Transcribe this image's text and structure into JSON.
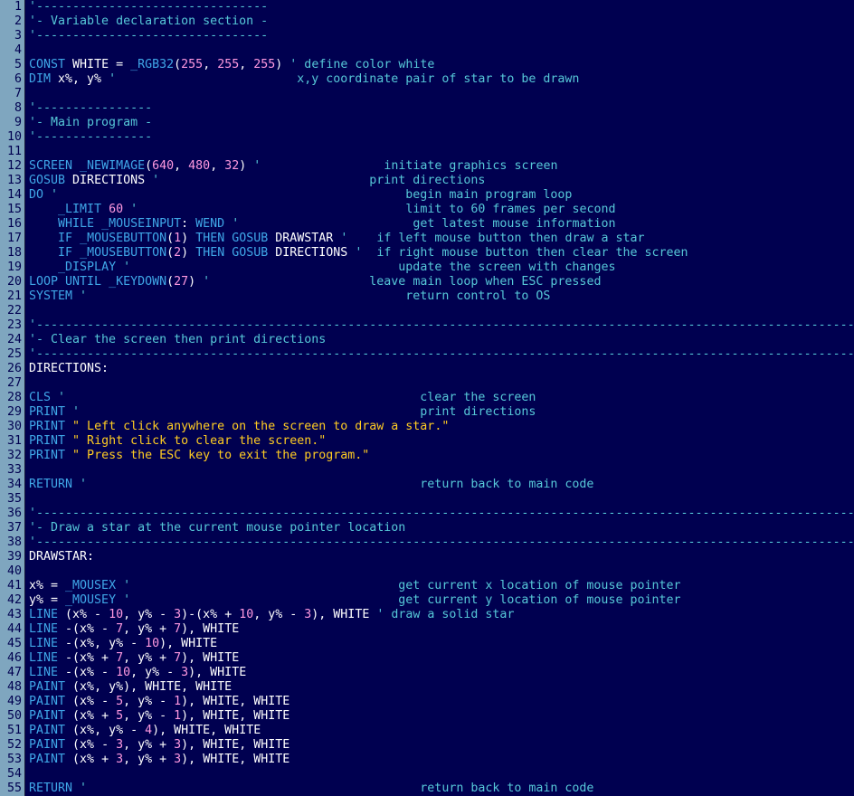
{
  "editor": {
    "theme": {
      "background": "#000050",
      "gutter": "#7fa6bf",
      "comment": "#56c8d8",
      "keyword": "#3fa7e8",
      "identifier": "#ffffff",
      "number": "#ff99e0",
      "string": "#ffcc22"
    },
    "lines": [
      [
        [
          "cm",
          "'--------------------------------"
        ]
      ],
      [
        [
          "cm",
          "'- Variable declaration section -"
        ]
      ],
      [
        [
          "cm",
          "'--------------------------------"
        ]
      ],
      [],
      [
        [
          "kw",
          "CONST "
        ],
        [
          "id",
          "WHITE = "
        ],
        [
          "mt",
          "_RGB32"
        ],
        [
          "op",
          "("
        ],
        [
          "num",
          "255"
        ],
        [
          "op",
          ", "
        ],
        [
          "num",
          "255"
        ],
        [
          "op",
          ", "
        ],
        [
          "num",
          "255"
        ],
        [
          "op",
          ") "
        ],
        [
          "cm",
          "' define color white"
        ]
      ],
      [
        [
          "kw",
          "DIM "
        ],
        [
          "id",
          "x%, y% "
        ],
        [
          "cm",
          "'                         x,y coordinate pair of star to be drawn"
        ]
      ],
      [],
      [
        [
          "cm",
          "'----------------"
        ]
      ],
      [
        [
          "cm",
          "'- Main program -"
        ]
      ],
      [
        [
          "cm",
          "'----------------"
        ]
      ],
      [],
      [
        [
          "kw",
          "SCREEN "
        ],
        [
          "mt",
          "_NEWIMAGE"
        ],
        [
          "op",
          "("
        ],
        [
          "num",
          "640"
        ],
        [
          "op",
          ", "
        ],
        [
          "num",
          "480"
        ],
        [
          "op",
          ", "
        ],
        [
          "num",
          "32"
        ],
        [
          "op",
          ") "
        ],
        [
          "cm",
          "'                 initiate graphics screen"
        ]
      ],
      [
        [
          "kw",
          "GOSUB "
        ],
        [
          "id",
          "DIRECTIONS "
        ],
        [
          "cm",
          "'                             print directions"
        ]
      ],
      [
        [
          "kw",
          "DO "
        ],
        [
          "cm",
          "'                                                begin main program loop"
        ]
      ],
      [
        [
          "op",
          "    "
        ],
        [
          "mt",
          "_LIMIT "
        ],
        [
          "num",
          "60 "
        ],
        [
          "cm",
          "'                                     limit to 60 frames per second"
        ]
      ],
      [
        [
          "op",
          "    "
        ],
        [
          "kw",
          "WHILE "
        ],
        [
          "mt",
          "_MOUSEINPUT"
        ],
        [
          "op",
          ": "
        ],
        [
          "kw",
          "WEND "
        ],
        [
          "cm",
          "'                        get latest mouse information"
        ]
      ],
      [
        [
          "op",
          "    "
        ],
        [
          "kw",
          "IF "
        ],
        [
          "mt",
          "_MOUSEBUTTON"
        ],
        [
          "op",
          "("
        ],
        [
          "num",
          "1"
        ],
        [
          "op",
          ") "
        ],
        [
          "kw",
          "THEN GOSUB "
        ],
        [
          "id",
          "DRAWSTAR "
        ],
        [
          "cm",
          "'    if left mouse button then draw a star"
        ]
      ],
      [
        [
          "op",
          "    "
        ],
        [
          "kw",
          "IF "
        ],
        [
          "mt",
          "_MOUSEBUTTON"
        ],
        [
          "op",
          "("
        ],
        [
          "num",
          "2"
        ],
        [
          "op",
          ") "
        ],
        [
          "kw",
          "THEN GOSUB "
        ],
        [
          "id",
          "DIRECTIONS "
        ],
        [
          "cm",
          "'  if right mouse button then clear the screen"
        ]
      ],
      [
        [
          "op",
          "    "
        ],
        [
          "mt",
          "_DISPLAY "
        ],
        [
          "cm",
          "'                                     update the screen with changes"
        ]
      ],
      [
        [
          "kw",
          "LOOP UNTIL "
        ],
        [
          "mt",
          "_KEYDOWN"
        ],
        [
          "op",
          "("
        ],
        [
          "num",
          "27"
        ],
        [
          "op",
          ") "
        ],
        [
          "cm",
          "'                      leave main loop when ESC pressed"
        ]
      ],
      [
        [
          "kw",
          "SYSTEM "
        ],
        [
          "cm",
          "'                                            return control to OS"
        ]
      ],
      [],
      [
        [
          "cm",
          "'-----------------------------------------------------------------------------------------------------------------------"
        ]
      ],
      [
        [
          "cm",
          "'- Clear the screen then print directions"
        ]
      ],
      [
        [
          "cm",
          "'-----------------------------------------------------------------------------------------------------------------------"
        ]
      ],
      [
        [
          "lb",
          "DIRECTIONS:"
        ]
      ],
      [],
      [
        [
          "kw",
          "CLS "
        ],
        [
          "cm",
          "'                                                 clear the screen"
        ]
      ],
      [
        [
          "kw",
          "PRINT "
        ],
        [
          "cm",
          "'                                               print directions"
        ]
      ],
      [
        [
          "kw",
          "PRINT "
        ],
        [
          "str",
          "\" Left click anywhere on the screen to draw a star.\""
        ]
      ],
      [
        [
          "kw",
          "PRINT "
        ],
        [
          "str",
          "\" Right click to clear the screen.\""
        ]
      ],
      [
        [
          "kw",
          "PRINT "
        ],
        [
          "str",
          "\" Press the ESC key to exit the program.\""
        ]
      ],
      [],
      [
        [
          "kw",
          "RETURN "
        ],
        [
          "cm",
          "'                                              return back to main code"
        ]
      ],
      [],
      [
        [
          "cm",
          "'-----------------------------------------------------------------------------------------------------------------------"
        ]
      ],
      [
        [
          "cm",
          "'- Draw a star at the current mouse pointer location"
        ]
      ],
      [
        [
          "cm",
          "'-----------------------------------------------------------------------------------------------------------------------"
        ]
      ],
      [
        [
          "lb",
          "DRAWSTAR:"
        ]
      ],
      [],
      [
        [
          "id",
          "x% = "
        ],
        [
          "mt",
          "_MOUSEX "
        ],
        [
          "cm",
          "'                                     get current x location of mouse pointer"
        ]
      ],
      [
        [
          "id",
          "y% = "
        ],
        [
          "mt",
          "_MOUSEY "
        ],
        [
          "cm",
          "'                                     get current y location of mouse pointer"
        ]
      ],
      [
        [
          "kw",
          "LINE "
        ],
        [
          "op",
          "(x% - "
        ],
        [
          "num",
          "10"
        ],
        [
          "op",
          ", y% - "
        ],
        [
          "num",
          "3"
        ],
        [
          "op",
          ")-(x% + "
        ],
        [
          "num",
          "10"
        ],
        [
          "op",
          ", y% - "
        ],
        [
          "num",
          "3"
        ],
        [
          "op",
          "), WHITE "
        ],
        [
          "cm",
          "' draw a solid star"
        ]
      ],
      [
        [
          "kw",
          "LINE "
        ],
        [
          "op",
          "-(x% - "
        ],
        [
          "num",
          "7"
        ],
        [
          "op",
          ", y% + "
        ],
        [
          "num",
          "7"
        ],
        [
          "op",
          "), WHITE"
        ]
      ],
      [
        [
          "kw",
          "LINE "
        ],
        [
          "op",
          "-(x%, y% - "
        ],
        [
          "num",
          "10"
        ],
        [
          "op",
          "), WHITE"
        ]
      ],
      [
        [
          "kw",
          "LINE "
        ],
        [
          "op",
          "-(x% + "
        ],
        [
          "num",
          "7"
        ],
        [
          "op",
          ", y% + "
        ],
        [
          "num",
          "7"
        ],
        [
          "op",
          "), WHITE"
        ]
      ],
      [
        [
          "kw",
          "LINE "
        ],
        [
          "op",
          "-(x% - "
        ],
        [
          "num",
          "10"
        ],
        [
          "op",
          ", y% - "
        ],
        [
          "num",
          "3"
        ],
        [
          "op",
          "), WHITE"
        ]
      ],
      [
        [
          "kw",
          "PAINT "
        ],
        [
          "op",
          "(x%, y%), WHITE, WHITE"
        ]
      ],
      [
        [
          "kw",
          "PAINT "
        ],
        [
          "op",
          "(x% - "
        ],
        [
          "num",
          "5"
        ],
        [
          "op",
          ", y% - "
        ],
        [
          "num",
          "1"
        ],
        [
          "op",
          "), WHITE, WHITE"
        ]
      ],
      [
        [
          "kw",
          "PAINT "
        ],
        [
          "op",
          "(x% + "
        ],
        [
          "num",
          "5"
        ],
        [
          "op",
          ", y% - "
        ],
        [
          "num",
          "1"
        ],
        [
          "op",
          "), WHITE, WHITE"
        ]
      ],
      [
        [
          "kw",
          "PAINT "
        ],
        [
          "op",
          "(x%, y% - "
        ],
        [
          "num",
          "4"
        ],
        [
          "op",
          "), WHITE, WHITE"
        ]
      ],
      [
        [
          "kw",
          "PAINT "
        ],
        [
          "op",
          "(x% - "
        ],
        [
          "num",
          "3"
        ],
        [
          "op",
          ", y% + "
        ],
        [
          "num",
          "3"
        ],
        [
          "op",
          "), WHITE, WHITE"
        ]
      ],
      [
        [
          "kw",
          "PAINT "
        ],
        [
          "op",
          "(x% + "
        ],
        [
          "num",
          "3"
        ],
        [
          "op",
          ", y% + "
        ],
        [
          "num",
          "3"
        ],
        [
          "op",
          "), WHITE, WHITE"
        ]
      ],
      [],
      [
        [
          "kw",
          "RETURN "
        ],
        [
          "cm",
          "'                                              return back to main code"
        ]
      ]
    ],
    "line_numbers": [
      "1",
      "2",
      "3",
      "4",
      "5",
      "6",
      "7",
      "8",
      "9",
      "10",
      "11",
      "12",
      "13",
      "14",
      "15",
      "16",
      "17",
      "18",
      "19",
      "20",
      "21",
      "22",
      "23",
      "24",
      "25",
      "26",
      "27",
      "28",
      "29",
      "30",
      "31",
      "32",
      "33",
      "34",
      "35",
      "36",
      "37",
      "38",
      "39",
      "40",
      "41",
      "42",
      "43",
      "44",
      "45",
      "46",
      "47",
      "48",
      "49",
      "50",
      "51",
      "52",
      "53",
      "54",
      "55"
    ]
  }
}
